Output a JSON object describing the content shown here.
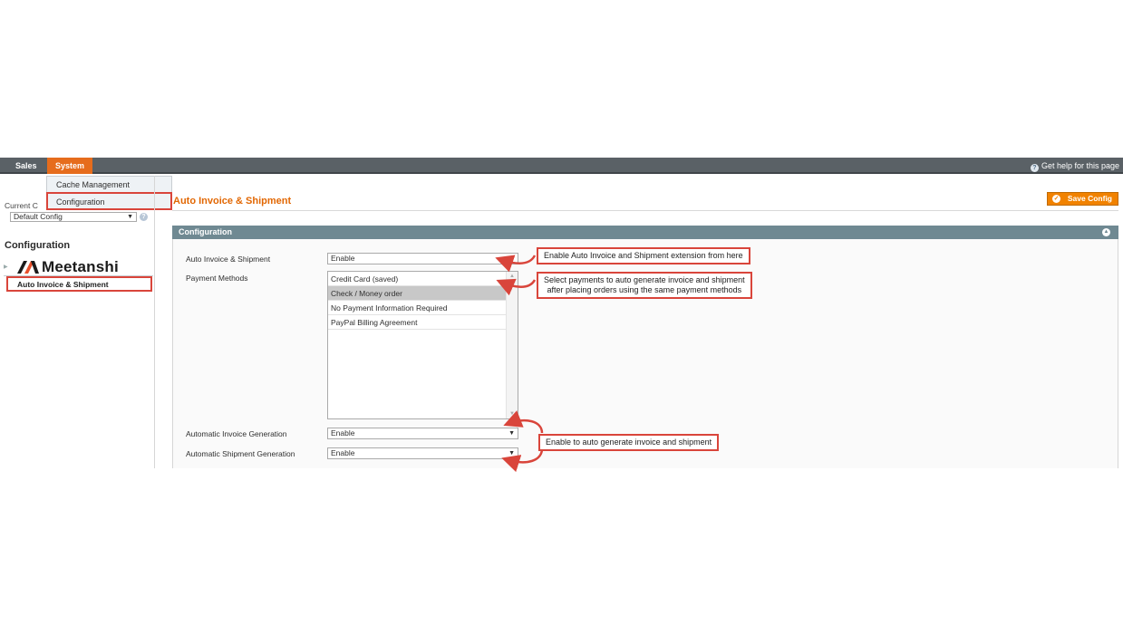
{
  "nav": {
    "items": [
      "Sales",
      "System"
    ],
    "help": "Get help for this page"
  },
  "dropdown": {
    "items": [
      "Cache Management",
      "Configuration"
    ]
  },
  "scope": {
    "label": "Current C",
    "value": "Default Config"
  },
  "sidebar": {
    "title": "Configuration",
    "group": "Meetanshi",
    "item": "Auto Invoice & Shipment"
  },
  "page": {
    "title": "Auto Invoice & Shipment",
    "save_label": "Save Config"
  },
  "section": {
    "title": "Configuration"
  },
  "fields": {
    "auto_invoice_label": "Auto Invoice & Shipment",
    "auto_invoice_value": "Enable",
    "payment_methods_label": "Payment Methods",
    "payment_options": [
      "Credit Card (saved)",
      "Check / Money order",
      "No Payment Information Required",
      "PayPal Billing Agreement"
    ],
    "payment_selected": "Check / Money order",
    "invoice_gen_label": "Automatic Invoice Generation",
    "invoice_gen_value": "Enable",
    "shipment_gen_label": "Automatic Shipment Generation",
    "shipment_gen_value": "Enable"
  },
  "callouts": {
    "enable_ext": "Enable Auto Invoice and Shipment extension from here",
    "payments_line1": "Select payments to auto generate invoice and shipment",
    "payments_line2": "after placing orders using the same payment methods",
    "auto_gen": "Enable to auto generate invoice and shipment"
  },
  "colors": {
    "accent": "#e66c1c",
    "navbar": "#5a6166",
    "section_header": "#6f8992",
    "highlight": "#d9453b"
  }
}
